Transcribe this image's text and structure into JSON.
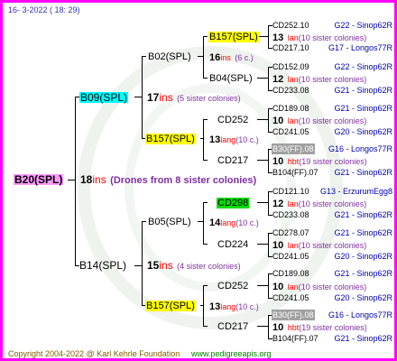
{
  "header": {
    "date": "16-  3-2022 ( 18:  29)"
  },
  "footer": {
    "copyright": "Copyright 2004-2022 @ Karl Kehrle Foundation",
    "url": "www.pedigreeapis.org"
  },
  "root": {
    "label": "B20(SPL)",
    "num": "18",
    "ins": "ins",
    "note": "(Drones from 8 sister colonies)"
  },
  "gen1": [
    {
      "label": "B09(SPL)",
      "num": "17",
      "ins": "ins",
      "note": "(5 sister colonies)"
    },
    {
      "label": "B14(SPL)",
      "num": "15",
      "ins": "ins",
      "note": "(4 sister colonies)"
    }
  ],
  "gen2": [
    {
      "label": "B02(SPL)",
      "num": "16",
      "ins": "ins",
      "note": "(6 c.)"
    },
    {
      "label": "B157(SPL)",
      "num": "13",
      "ins": "lang",
      "note": "(10 c.)"
    },
    {
      "label": "B05(SPL)",
      "num": "14",
      "ins": "lang",
      "note": "(10 c.)"
    },
    {
      "label": "B157(SPL)",
      "num": "13",
      "ins": "lang",
      "note": "(10 c.)"
    }
  ],
  "gen3": [
    {
      "label": "B157(SPL)",
      "num": "13",
      "ins": "lan",
      "note": "(10 sister colonies)"
    },
    {
      "label": "B04(SPL)",
      "num": "12",
      "ins": "lan",
      "note": "(10 sister colonies)"
    },
    {
      "label": "CD252",
      "num": "10",
      "ins": "lan",
      "note": "(10 sister colonies)"
    },
    {
      "label": "CD217",
      "num": "10",
      "ins": "hbt",
      "note": "(19 sister colonies)"
    },
    {
      "label": "CD298",
      "num": "12",
      "ins": "lan",
      "note": "(10 sister colonies)"
    },
    {
      "label": "CD224",
      "num": "10",
      "ins": "lan",
      "note": "(10 sister colonies)"
    },
    {
      "label": "CD252",
      "num": "10",
      "ins": "lan",
      "note": "(10 sister colonies)"
    },
    {
      "label": "CD217",
      "num": "10",
      "ins": "hbt",
      "note": "(19 sister colonies)"
    }
  ],
  "gen4": [
    {
      "label": "CD252.10",
      "origin": "G22 - Sinop62R"
    },
    {
      "label": "CD217.10",
      "origin": "G17 - Longos77R"
    },
    {
      "label": "CD152.09",
      "origin": "G22 - Sinop62R"
    },
    {
      "label": "CD233.08",
      "origin": "G21 - Sinop62R"
    },
    {
      "label": "CD189.08",
      "origin": "G21 - Sinop62R"
    },
    {
      "label": "CD241.05",
      "origin": "G20 - Sinop62R"
    },
    {
      "label": "B30(FF).08",
      "origin": "G16 - Longos77R"
    },
    {
      "label": "B104(FF).07",
      "origin": "G21 - Sinop62R"
    },
    {
      "label": "CD121.10",
      "origin": "G13 - ErzurumEgg8"
    },
    {
      "label": "CD233.08",
      "origin": "G21 - Sinop62R"
    },
    {
      "label": "CD278.07",
      "origin": "G21 - Sinop62R"
    },
    {
      "label": "CD241.05",
      "origin": "G20 - Sinop62R"
    },
    {
      "label": "CD189.08",
      "origin": "G21 - Sinop62R"
    },
    {
      "label": "CD241.05",
      "origin": "G20 - Sinop62R"
    },
    {
      "label": "B30(FF).08",
      "origin": "G16 - Longos77R"
    },
    {
      "label": "B104(FF).07",
      "origin": "G21 - Sinop62R"
    }
  ]
}
